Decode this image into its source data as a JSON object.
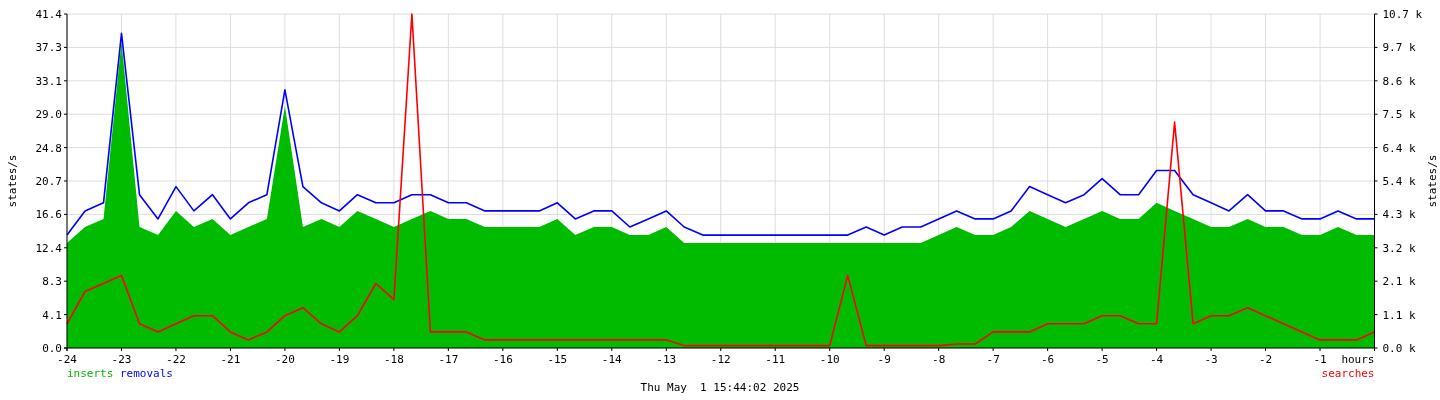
{
  "chart_data": {
    "type": "area",
    "grid": true,
    "xlabel": "hours",
    "ylabel": "states/s",
    "xlim": [
      -24,
      0
    ],
    "ylim": [
      0,
      41.4
    ],
    "xticks": [
      -24,
      -23,
      -22,
      -21,
      -20,
      -19,
      -18,
      -17,
      -16,
      -15,
      -14,
      -13,
      -12,
      -11,
      -10,
      -9,
      -8,
      -7,
      -6,
      -5,
      -4,
      -3,
      -2,
      -1
    ],
    "yticks": [
      {
        "value": 0,
        "label": "0.0"
      },
      {
        "value": 4.14,
        "label": "4.1"
      },
      {
        "value": 8.28,
        "label": "8.3"
      },
      {
        "value": 12.42,
        "label": "12.4"
      },
      {
        "value": 16.56,
        "label": "16.6"
      },
      {
        "value": 20.7,
        "label": "20.7"
      },
      {
        "value": 24.84,
        "label": "24.8"
      },
      {
        "value": 28.98,
        "label": "29.0"
      },
      {
        "value": 33.12,
        "label": "33.1"
      },
      {
        "value": 37.26,
        "label": "37.3"
      },
      {
        "value": 41.4,
        "label": "41.4"
      }
    ],
    "x": [
      -24,
      -23.67,
      -23.33,
      -23,
      -22.67,
      -22.33,
      -22,
      -21.67,
      -21.33,
      -21,
      -20.67,
      -20.33,
      -20,
      -19.67,
      -19.33,
      -19,
      -18.67,
      -18.33,
      -18,
      -17.67,
      -17.33,
      -17,
      -16.67,
      -16.33,
      -16,
      -15.67,
      -15.33,
      -15,
      -14.67,
      -14.33,
      -14,
      -13.67,
      -13.33,
      -13,
      -12.67,
      -12.33,
      -12,
      -11.67,
      -11.33,
      -11,
      -10.67,
      -10.33,
      -10,
      -9.67,
      -9.33,
      -9,
      -8.67,
      -8.33,
      -8,
      -7.67,
      -7.33,
      -7,
      -6.67,
      -6.33,
      -6,
      -5.67,
      -5.33,
      -5,
      -4.67,
      -4.33,
      -4,
      -3.67,
      -3.33,
      -3,
      -2.67,
      -2.33,
      -2,
      -1.67,
      -1.33,
      -1,
      -0.67,
      -0.33,
      0
    ],
    "series": [
      {
        "name": "inserts",
        "color": "#00bb00",
        "type": "area",
        "values": [
          13,
          15,
          16,
          38,
          15,
          14,
          17,
          15,
          16,
          14,
          15,
          16,
          30,
          15,
          16,
          15,
          17,
          16,
          15,
          16,
          17,
          16,
          16,
          15,
          15,
          15,
          15,
          16,
          14,
          15,
          15,
          14,
          14,
          15,
          13,
          13,
          13,
          13,
          13,
          13,
          13,
          13,
          13,
          13,
          13,
          13,
          13,
          13,
          14,
          15,
          14,
          14,
          15,
          17,
          16,
          15,
          16,
          17,
          16,
          16,
          18,
          17,
          16,
          15,
          15,
          16,
          15,
          15,
          14,
          14,
          15,
          14,
          14
        ]
      },
      {
        "name": "removals",
        "color": "#0000ff",
        "type": "line",
        "values": [
          14,
          17,
          18,
          39,
          19,
          16,
          20,
          17,
          19,
          16,
          18,
          19,
          32,
          20,
          18,
          17,
          19,
          18,
          18,
          19,
          19,
          18,
          18,
          17,
          17,
          17,
          17,
          18,
          16,
          17,
          17,
          15,
          16,
          17,
          15,
          14,
          14,
          14,
          14,
          14,
          14,
          14,
          14,
          14,
          15,
          14,
          15,
          15,
          16,
          17,
          16,
          16,
          17,
          20,
          19,
          18,
          19,
          21,
          19,
          19,
          22,
          22,
          19,
          18,
          17,
          19,
          17,
          17,
          16,
          16,
          17,
          16,
          16
        ]
      },
      {
        "name": "searches",
        "color": "#ff0000",
        "type": "line",
        "values": [
          3,
          7,
          8,
          9,
          3,
          2,
          3,
          4,
          4,
          2,
          1,
          2,
          4,
          5,
          3,
          2,
          4,
          8,
          6,
          41.4,
          2,
          2,
          2,
          1,
          1,
          1,
          1,
          1,
          1,
          1,
          1,
          1,
          1,
          1,
          0.3,
          0.3,
          0.3,
          0.3,
          0.3,
          0.3,
          0.3,
          0.3,
          0.3,
          9,
          0.3,
          0.3,
          0.3,
          0.3,
          0.3,
          0.5,
          0.5,
          2,
          2,
          2,
          3,
          3,
          3,
          4,
          4,
          3,
          3,
          28,
          3,
          4,
          4,
          5,
          4,
          3,
          2,
          1,
          1,
          1,
          2
        ]
      }
    ]
  },
  "right_axis": {
    "label": "states/s",
    "ticks": [
      "10.7 k",
      "9.7 k",
      "8.6 k",
      "7.5 k",
      "6.4 k",
      "5.4 k",
      "4.3 k",
      "3.2 k",
      "2.1 k",
      "1.1 k",
      "0.0 k"
    ]
  },
  "timestamp": "Thu May  1 15:44:02 2025"
}
